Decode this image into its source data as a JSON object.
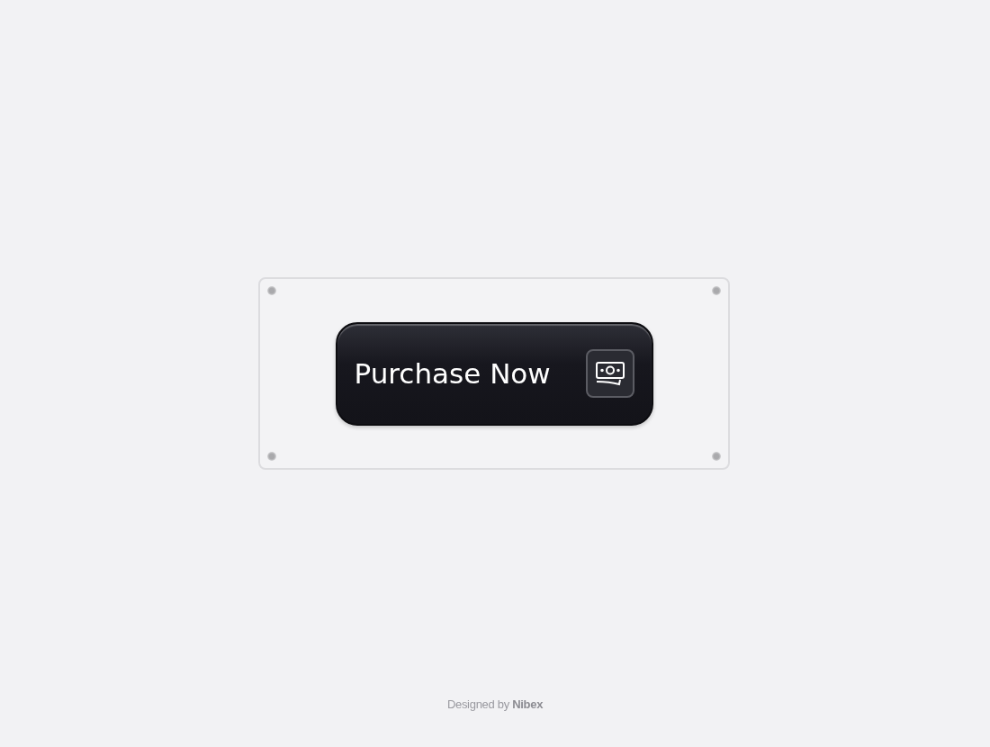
{
  "button": {
    "label": "Purchase Now"
  },
  "credit": "Designed by **Nibex**"
}
